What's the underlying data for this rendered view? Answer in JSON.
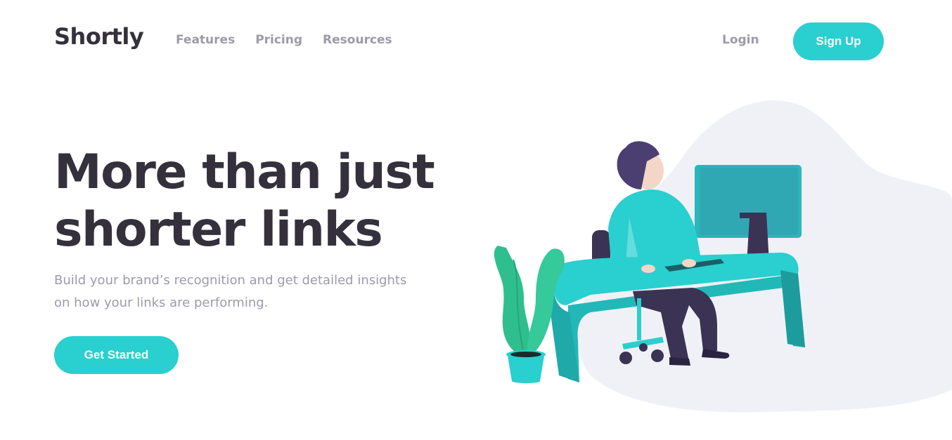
{
  "brand": {
    "name": "Shortly"
  },
  "nav": {
    "items": [
      {
        "label": "Features"
      },
      {
        "label": "Pricing"
      },
      {
        "label": "Resources"
      }
    ],
    "login_label": "Login",
    "signup_label": "Sign Up"
  },
  "hero": {
    "title_line1": "More than just",
    "title_line2": "shorter links",
    "subtitle_line1": "Build your brand’s recognition and get detailed insights",
    "subtitle_line2": "on how your links are performing.",
    "cta_label": "Get Started"
  },
  "colors": {
    "accent": "#2acfcf",
    "heading": "#34313d",
    "muted": "#9e9aa8",
    "blob": "#f0f1f6",
    "plant": "#2fbf8f",
    "hair": "#4b3f72"
  },
  "icons": {
    "illustration": "person-working-at-desk-illustration"
  }
}
